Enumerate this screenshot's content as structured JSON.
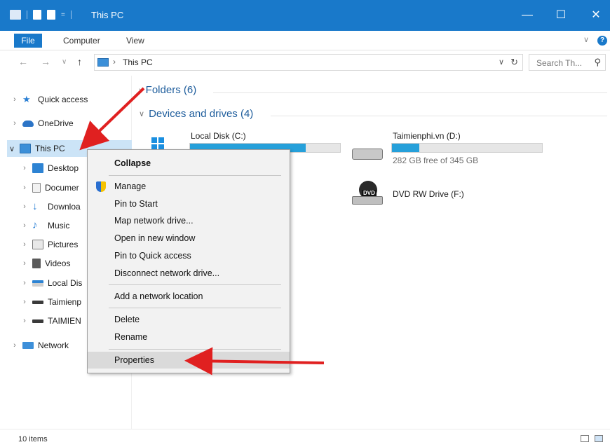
{
  "window": {
    "title": "This PC"
  },
  "ribbon": {
    "tabs": [
      "File",
      "Computer",
      "View"
    ]
  },
  "address": {
    "crumb": "This PC",
    "search_placeholder": "Search Th..."
  },
  "nav": {
    "items": [
      {
        "label": "Quick access",
        "icon": "star-icon"
      },
      {
        "label": "OneDrive",
        "icon": "cloud-icon"
      },
      {
        "label": "This PC",
        "icon": "computer-icon"
      },
      {
        "label": "Desktop",
        "icon": "desktop-icon"
      },
      {
        "label": "Documer",
        "icon": "document-icon"
      },
      {
        "label": "Downloa",
        "icon": "download-icon"
      },
      {
        "label": "Music",
        "icon": "music-icon"
      },
      {
        "label": "Pictures",
        "icon": "pictures-icon"
      },
      {
        "label": "Videos",
        "icon": "videos-icon"
      },
      {
        "label": "Local Dis",
        "icon": "local-disk-icon"
      },
      {
        "label": "Taimienp",
        "icon": "drive-icon"
      },
      {
        "label": "TAIMIEN",
        "icon": "drive-icon"
      },
      {
        "label": "Network",
        "icon": "network-icon"
      }
    ]
  },
  "content": {
    "folders_group": "Folders (6)",
    "devices_group": "Devices and drives (4)",
    "drives": [
      {
        "name": "Local Disk (C:)",
        "used_fraction": 0.77,
        "free_text": ""
      },
      {
        "name": "Taimienphi.vn (D:)",
        "used_fraction": 0.18,
        "free_text": "282 GB free of 345 GB"
      },
      {
        "name": "DVD RW Drive (F:)",
        "badge": "DVD"
      }
    ]
  },
  "context_menu": {
    "items": [
      "Collapse",
      "Manage",
      "Pin to Start",
      "Map network drive...",
      "Open in new window",
      "Pin to Quick access",
      "Disconnect network drive...",
      "Add a network location",
      "Delete",
      "Rename",
      "Properties"
    ]
  },
  "status": {
    "count": "10 items"
  },
  "colors": {
    "accent": "#1979ca",
    "arrow": "#e02020",
    "selection": "#cce4f7",
    "drive_fill": "#26a0da"
  }
}
